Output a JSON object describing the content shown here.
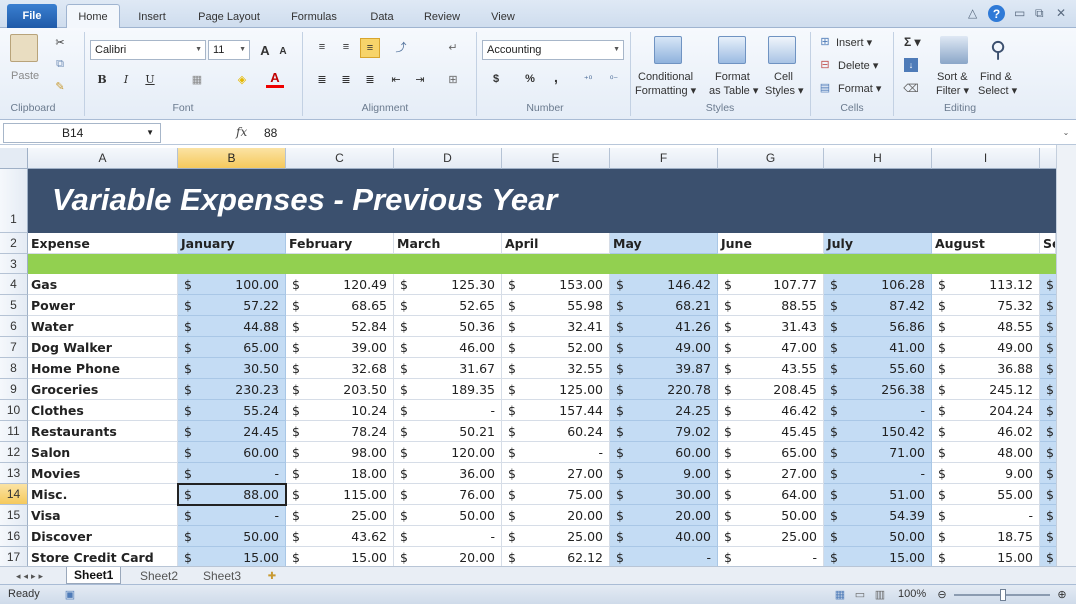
{
  "ribbon": {
    "file_tab": "File",
    "tabs": [
      "Home",
      "Insert",
      "Page Layout",
      "Formulas",
      "Data",
      "Review",
      "View"
    ],
    "clipboard": {
      "paste": "Paste",
      "group": "Clipboard"
    },
    "font": {
      "name": "Calibri",
      "size": "11",
      "bold": "B",
      "italic": "I",
      "underline": "U",
      "group": "Font"
    },
    "alignment": {
      "group": "Alignment"
    },
    "number": {
      "format": "Accounting",
      "dollar": "$",
      "percent": "%",
      "comma": ",",
      "group": "Number"
    },
    "styles": {
      "conditional": "Conditional",
      "formatting": "Formatting ▾",
      "format": "Format",
      "as_table": "as Table ▾",
      "cell": "Cell",
      "cell_styles": "Styles ▾",
      "group": "Styles"
    },
    "cells": {
      "insert": "Insert ▾",
      "delete": "Delete ▾",
      "format": "Format ▾",
      "group": "Cells"
    },
    "editing": {
      "sigma": "Σ ▾",
      "sort": "Sort &",
      "filter": "Filter ▾",
      "find": "Find &",
      "select": "Select ▾",
      "group": "Editing"
    }
  },
  "formula_bar": {
    "name_box": "B14",
    "fx": "fx",
    "value": "88"
  },
  "columns": [
    "A",
    "B",
    "C",
    "D",
    "E",
    "F",
    "G",
    "H",
    "I"
  ],
  "rows": [
    "1",
    "2",
    "3",
    "4",
    "5",
    "6",
    "7",
    "8",
    "9",
    "10",
    "11",
    "12",
    "13",
    "14",
    "15",
    "16",
    "17"
  ],
  "sheet": {
    "title": "Variable Expenses - Previous Year",
    "header_expense": "Expense",
    "months": [
      "January",
      "February",
      "March",
      "April",
      "May",
      "June",
      "July",
      "August",
      "Se"
    ],
    "expenses": [
      {
        "name": "Gas",
        "values": [
          "100.00",
          "120.49",
          "125.30",
          "153.00",
          "146.42",
          "107.77",
          "106.28",
          "113.12"
        ]
      },
      {
        "name": "Power",
        "values": [
          "57.22",
          "68.65",
          "52.65",
          "55.98",
          "68.21",
          "88.55",
          "87.42",
          "75.32"
        ]
      },
      {
        "name": "Water",
        "values": [
          "44.88",
          "52.84",
          "50.36",
          "32.41",
          "41.26",
          "31.43",
          "56.86",
          "48.55"
        ]
      },
      {
        "name": "Dog Walker",
        "values": [
          "65.00",
          "39.00",
          "46.00",
          "52.00",
          "49.00",
          "47.00",
          "41.00",
          "49.00"
        ]
      },
      {
        "name": "Home Phone",
        "values": [
          "30.50",
          "32.68",
          "31.67",
          "32.55",
          "39.87",
          "43.55",
          "55.60",
          "36.88"
        ]
      },
      {
        "name": "Groceries",
        "values": [
          "230.23",
          "203.50",
          "189.35",
          "125.00",
          "220.78",
          "208.45",
          "256.38",
          "245.12"
        ]
      },
      {
        "name": "Clothes",
        "values": [
          "55.24",
          "10.24",
          "-",
          "157.44",
          "24.25",
          "46.42",
          "-",
          "204.24"
        ]
      },
      {
        "name": "Restaurants",
        "values": [
          "24.45",
          "78.24",
          "50.21",
          "60.24",
          "79.02",
          "45.45",
          "150.42",
          "46.02"
        ]
      },
      {
        "name": "Salon",
        "values": [
          "60.00",
          "98.00",
          "120.00",
          "-",
          "60.00",
          "65.00",
          "71.00",
          "48.00"
        ]
      },
      {
        "name": "Movies",
        "values": [
          "-",
          "18.00",
          "36.00",
          "27.00",
          "9.00",
          "27.00",
          "-",
          "9.00"
        ]
      },
      {
        "name": "Misc.",
        "values": [
          "88.00",
          "115.00",
          "76.00",
          "75.00",
          "30.00",
          "64.00",
          "51.00",
          "55.00"
        ]
      },
      {
        "name": "Visa",
        "values": [
          "-",
          "25.00",
          "50.00",
          "20.00",
          "20.00",
          "50.00",
          "54.39",
          "-"
        ]
      },
      {
        "name": "Discover",
        "values": [
          "50.00",
          "43.62",
          "-",
          "25.00",
          "40.00",
          "25.00",
          "50.00",
          "18.75"
        ]
      },
      {
        "name": "Store Credit Card",
        "values": [
          "15.00",
          "15.00",
          "20.00",
          "62.12",
          "-",
          "-",
          "15.00",
          "15.00"
        ]
      }
    ],
    "currency": "$"
  },
  "sheet_tabs": [
    "Sheet1",
    "Sheet2",
    "Sheet3"
  ],
  "status": {
    "ready": "Ready",
    "zoom": "100%"
  },
  "colors": {
    "title_band": "#3b506e",
    "green_band": "#92d050",
    "blue_col": "#c4dcf4",
    "selection": "#f5c95c"
  }
}
